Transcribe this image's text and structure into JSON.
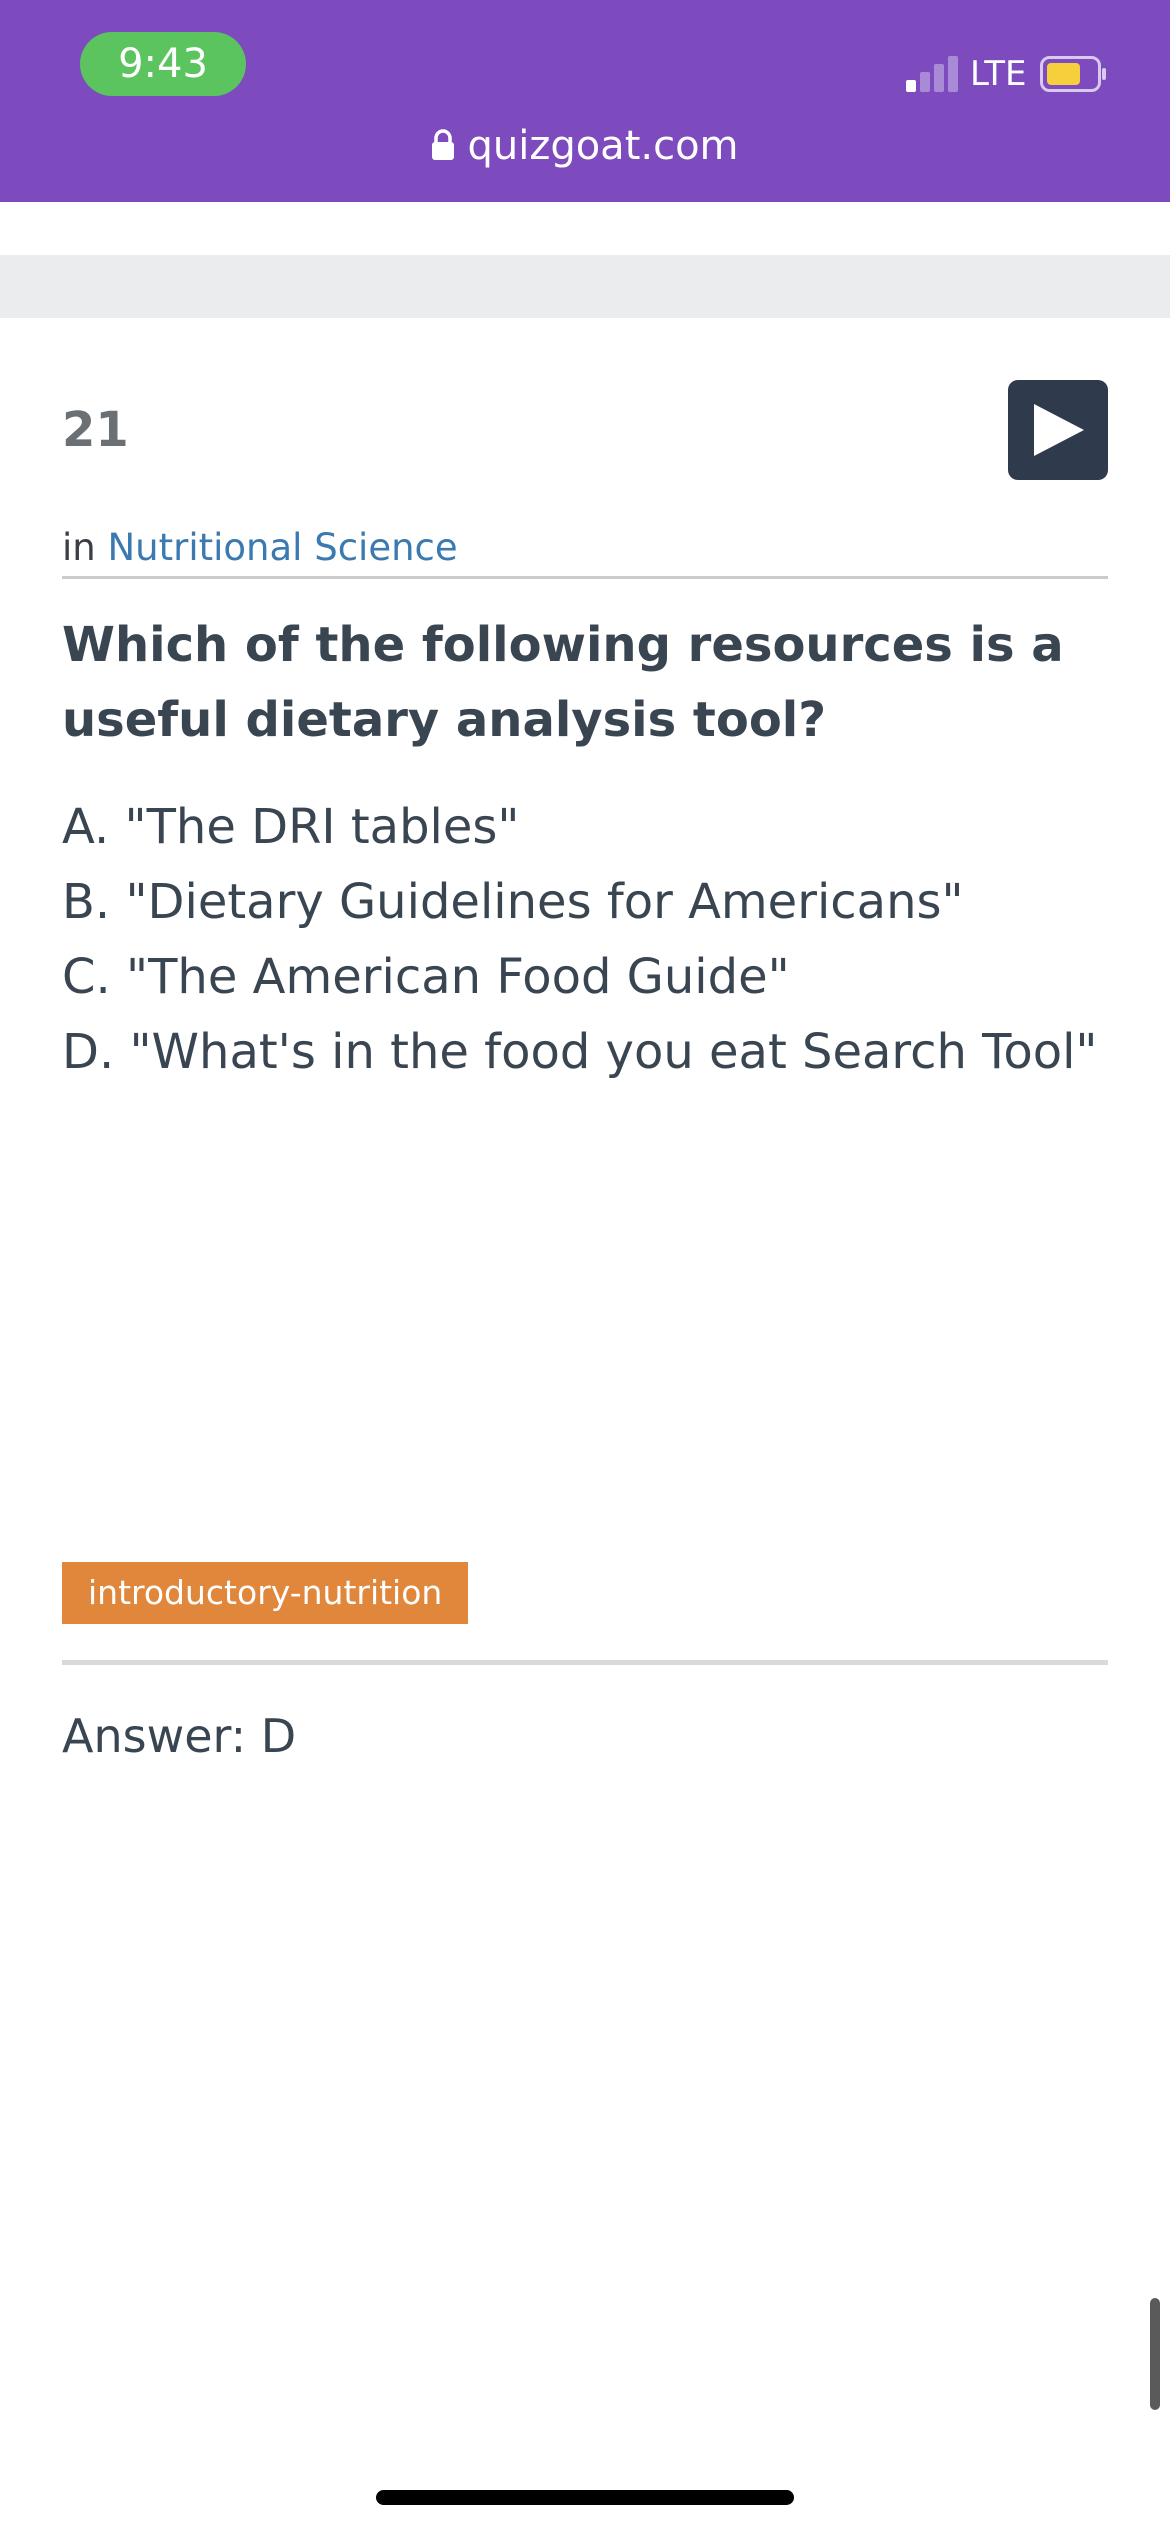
{
  "status_bar": {
    "time": "9:43",
    "network": "LTE",
    "url": "quizgoat.com",
    "colors": {
      "background": "#7d4bbd",
      "time_pill": "#5cc45e",
      "battery_fill": "#f5cf3c"
    },
    "icons": [
      "signal-icon",
      "battery-icon",
      "lock-icon"
    ]
  },
  "question": {
    "number": "21",
    "category_prefix": "in",
    "category": "Nutritional Science",
    "text": "Which of the following resources is a useful dietary analysis tool?",
    "options": [
      "A. \"The DRI tables\"",
      "B. \"Dietary Guidelines for Americans\"",
      "C. \"The American Food Guide\"",
      "D. \"What's in the food you eat Search Tool\""
    ],
    "play_icon": "play-icon"
  },
  "tag": {
    "label": "introductory-nutrition",
    "color": "#e0873c"
  },
  "answer": {
    "text": "Answer: D"
  }
}
